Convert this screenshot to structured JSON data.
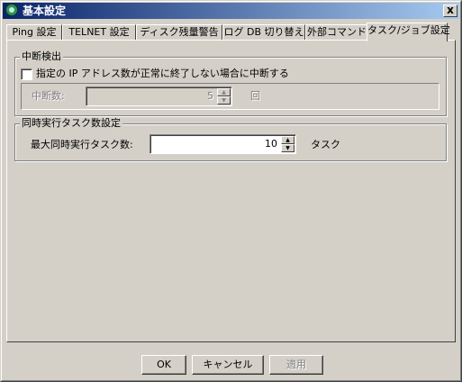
{
  "window": {
    "title": "基本設定",
    "close_label": "x"
  },
  "tabs": [
    {
      "label": "Ping 設定",
      "active": false
    },
    {
      "label": "TELNET 設定",
      "active": false
    },
    {
      "label": "ディスク残量警告",
      "active": false
    },
    {
      "label": "ログ DB 切り替え",
      "active": false
    },
    {
      "label": "外部コマンド",
      "active": false
    },
    {
      "label": "タスク/ジョブ設定",
      "active": true
    }
  ],
  "interrupt_group": {
    "legend": "中断検出",
    "checkbox_label": "指定の IP アドレス数が正常に終了しない場合に中断する",
    "checked": false,
    "count_label": "中断数:",
    "count_value": "5",
    "count_unit": "回"
  },
  "concurrency_group": {
    "legend": "同時実行タスク数設定",
    "max_label": "最大同時実行タスク数:",
    "max_value": "10",
    "max_unit": "タスク"
  },
  "buttons": {
    "ok": "OK",
    "cancel": "キャンセル",
    "apply": "適用"
  },
  "icons": {
    "title": "app-icon",
    "spin_up": "spin-up-icon",
    "spin_down": "spin-down-icon"
  }
}
